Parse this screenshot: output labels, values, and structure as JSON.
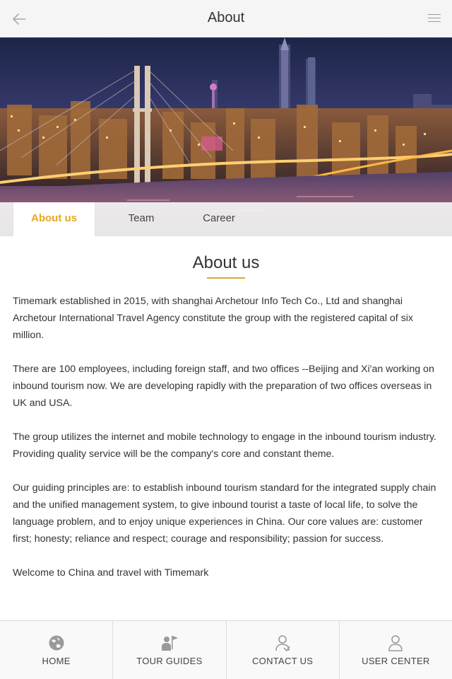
{
  "header": {
    "title": "About",
    "back_icon": "arrow-left-icon",
    "menu_icon": "hamburger-menu-icon"
  },
  "hero": {
    "image": "night-city-skyline-photo"
  },
  "tabs": [
    {
      "label": "About us",
      "active": true
    },
    {
      "label": "Team",
      "active": false
    },
    {
      "label": "Career",
      "active": false
    }
  ],
  "section": {
    "title": "About us",
    "paragraphs": [
      "Timemark established in 2015, with shanghai Archetour Info Tech Co., Ltd and shanghai Archetour International Travel Agency constitute the group with the registered capital of six million.",
      "There are 100 employees, including foreign staff, and two offices --Beijing and Xi'an working on inbound tourism now. We are developing rapidly with the preparation of two offices overseas in UK and USA.",
      "The group utilizes the internet and mobile technology to engage in the inbound tourism industry. Providing quality service will be the company's core and constant theme.",
      "Our guiding principles are: to establish inbound tourism standard for the integrated supply chain and the unified management system, to give inbound tourist a taste of local life, to solve the language problem, and to enjoy unique experiences in China. Our core values are: customer first; honesty; reliance and respect; courage and responsibility; passion for success.",
      "Welcome to China and travel with Timemark"
    ]
  },
  "bottom_nav": [
    {
      "label": "HOME",
      "icon": "home-globe-icon"
    },
    {
      "label": "TOUR GUIDES",
      "icon": "tour-guide-flag-icon"
    },
    {
      "label": "CONTACT US",
      "icon": "contact-person-icon"
    },
    {
      "label": "USER CENTER",
      "icon": "user-icon"
    }
  ],
  "colors": {
    "accent": "#e7a81f",
    "underline": "#d9a735",
    "header_bg": "#f5f5f5"
  }
}
